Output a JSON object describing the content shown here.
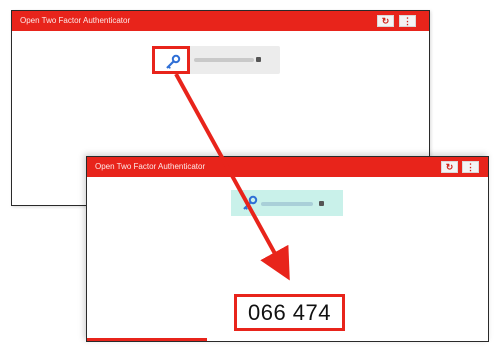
{
  "windows": {
    "back": {
      "title": "Open Two Factor Authenticator",
      "refresh_icon": "refresh-icon",
      "menu_icon": "menu-icon",
      "key_icon": "key-icon"
    },
    "front": {
      "title": "Open Two Factor Authenticator",
      "refresh_icon": "refresh-icon",
      "menu_icon": "menu-icon",
      "key_icon": "key-icon",
      "code": "066 474"
    }
  },
  "colors": {
    "titlebar": "#e8241b",
    "highlight": "#e8241b",
    "selected_entry": "#c9f1ea"
  }
}
